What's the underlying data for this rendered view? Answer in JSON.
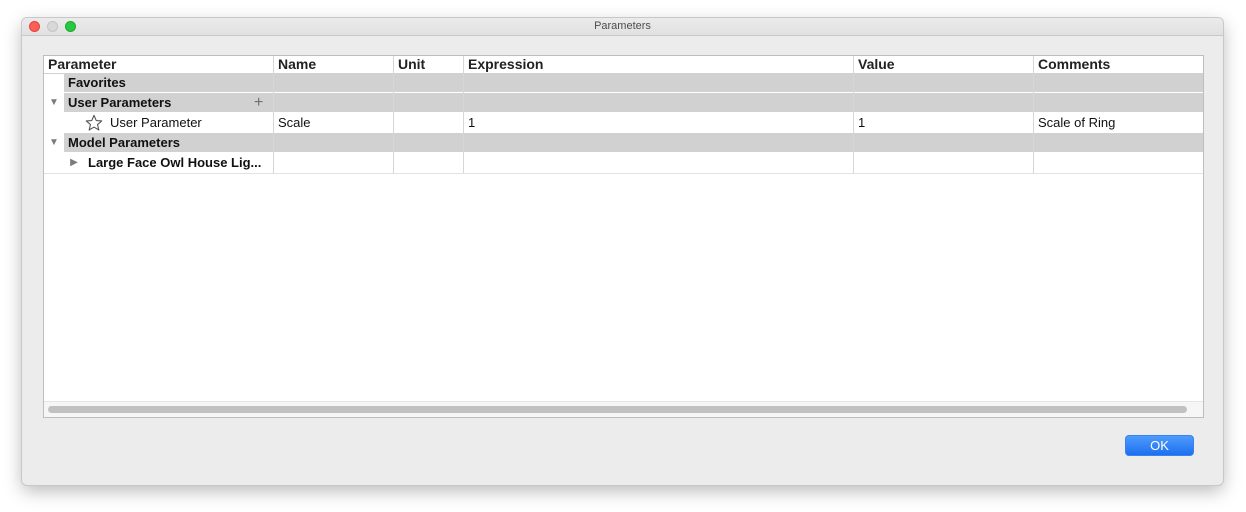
{
  "window": {
    "title": "Parameters"
  },
  "table": {
    "columns": [
      "Parameter",
      "Name",
      "Unit",
      "Expression",
      "Value",
      "Comments"
    ],
    "groups": {
      "favorites": {
        "label": "Favorites"
      },
      "user_parameters": {
        "label": "User Parameters",
        "add_icon": "plus-icon",
        "rows": [
          {
            "parameter": "User Parameter",
            "name": "Scale",
            "unit": "",
            "expression": "1",
            "value": "1",
            "comments": "Scale of Ring",
            "icon": "star-icon"
          }
        ]
      },
      "model_parameters": {
        "label": "Model Parameters",
        "rows": [
          {
            "parameter": "Large Face Owl House Lig...",
            "name": "",
            "unit": "",
            "expression": "",
            "value": "",
            "comments": ""
          }
        ]
      }
    }
  },
  "buttons": {
    "ok": "OK"
  },
  "colors": {
    "accent": "#1d6ff0",
    "group_band": "#d1d1d1"
  }
}
